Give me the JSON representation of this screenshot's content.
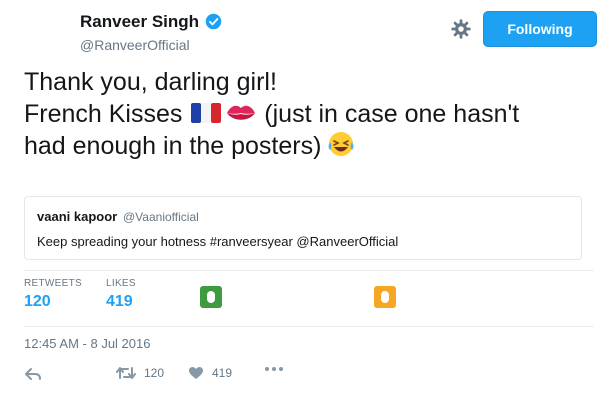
{
  "author": {
    "name": "Ranveer Singh",
    "handle": "@RanveerOfficial"
  },
  "follow_button": {
    "label": "Following"
  },
  "tweet": {
    "line1": "Thank you, darling girl!",
    "line2_prefix": "French Kisses",
    "line2_suffix": "(just in case one hasn't",
    "line3": "had enough in the posters)",
    "emojis": [
      "france-flag-icon",
      "kiss-mark-icon",
      "laughing-tears-icon"
    ]
  },
  "quoted_tweet": {
    "name": "vaani kapoor",
    "handle": "@Vaaniofficial",
    "text": "Keep spreading your hotness #ranveersyear @RanveerOfficial"
  },
  "stats": {
    "retweets_label": "RETWEETS",
    "retweets_count": "120",
    "likes_label": "LIKES",
    "likes_count": "419"
  },
  "liker_avatars": [
    {
      "color": "#3f9b3f"
    },
    {
      "color": "#f5a623"
    }
  ],
  "timestamp": "12:45 AM - 8 Jul 2016",
  "actions": {
    "retweet_count": "120",
    "like_count": "419"
  },
  "colors": {
    "accent": "#1da1f2",
    "muted": "#657786",
    "border": "#e1e8ed"
  }
}
